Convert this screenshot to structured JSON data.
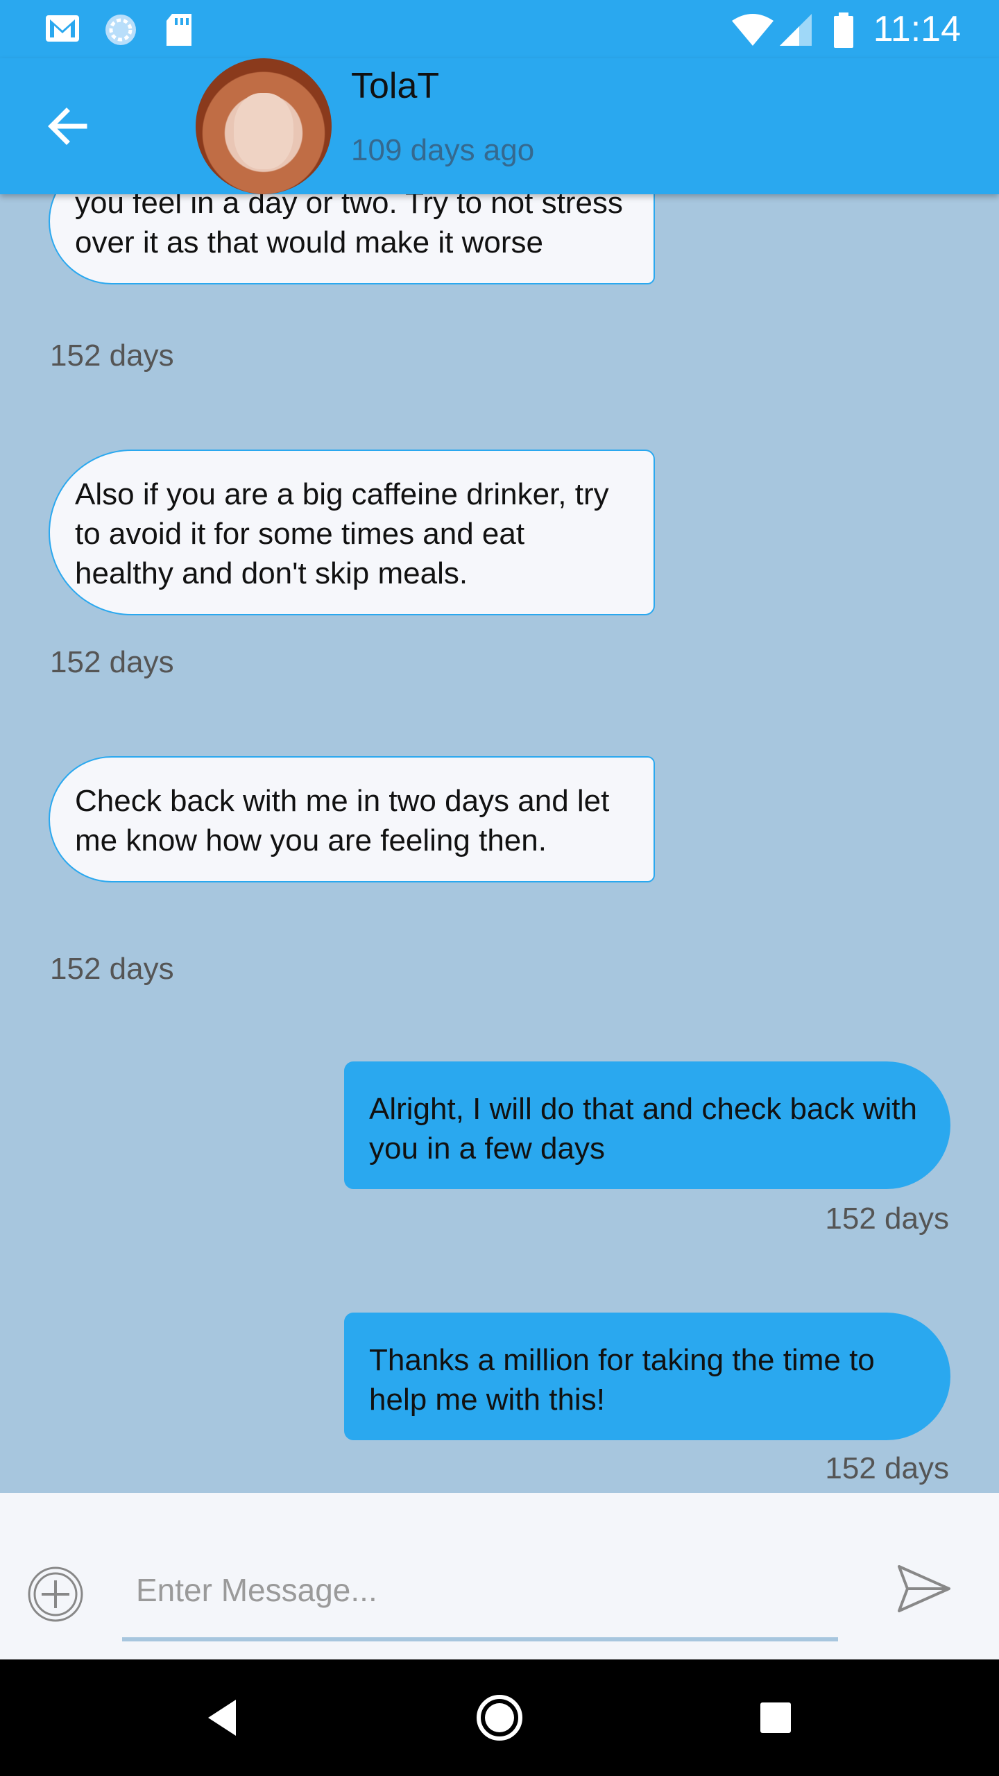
{
  "status_bar": {
    "time": "11:14",
    "icons": [
      "gmail-icon",
      "sync-icon",
      "sd-card-icon",
      "wifi-icon",
      "signal-icon",
      "battery-icon"
    ]
  },
  "header": {
    "contact_name": "TolaT",
    "last_seen": "109 days ago",
    "back_icon": "arrow-left-icon"
  },
  "messages": [
    {
      "direction": "in",
      "text": "you feel in a day or two. Try to not stress over it as that would make it worse",
      "time": "152 days"
    },
    {
      "direction": "in",
      "text": "Also if you are a big caffeine drinker, try to avoid it for some times and eat healthy and don't skip meals.",
      "time": "152 days"
    },
    {
      "direction": "in",
      "text": "Check back with me in two days and let me know how you are feeling then.",
      "time": "152 days"
    },
    {
      "direction": "out",
      "text": "Alright, I will do that and check back with you in a few days",
      "time": "152 days"
    },
    {
      "direction": "out",
      "text": "Thanks a million for taking the time to help me with this!",
      "time": "152 days"
    }
  ],
  "composer": {
    "placeholder": "Enter Message...",
    "attach_icon": "plus-circle-icon",
    "send_icon": "send-icon"
  },
  "colors": {
    "primary": "#2aa8ef",
    "chat_background": "#a7c6de",
    "incoming_bubble": "#f6f7fb"
  }
}
